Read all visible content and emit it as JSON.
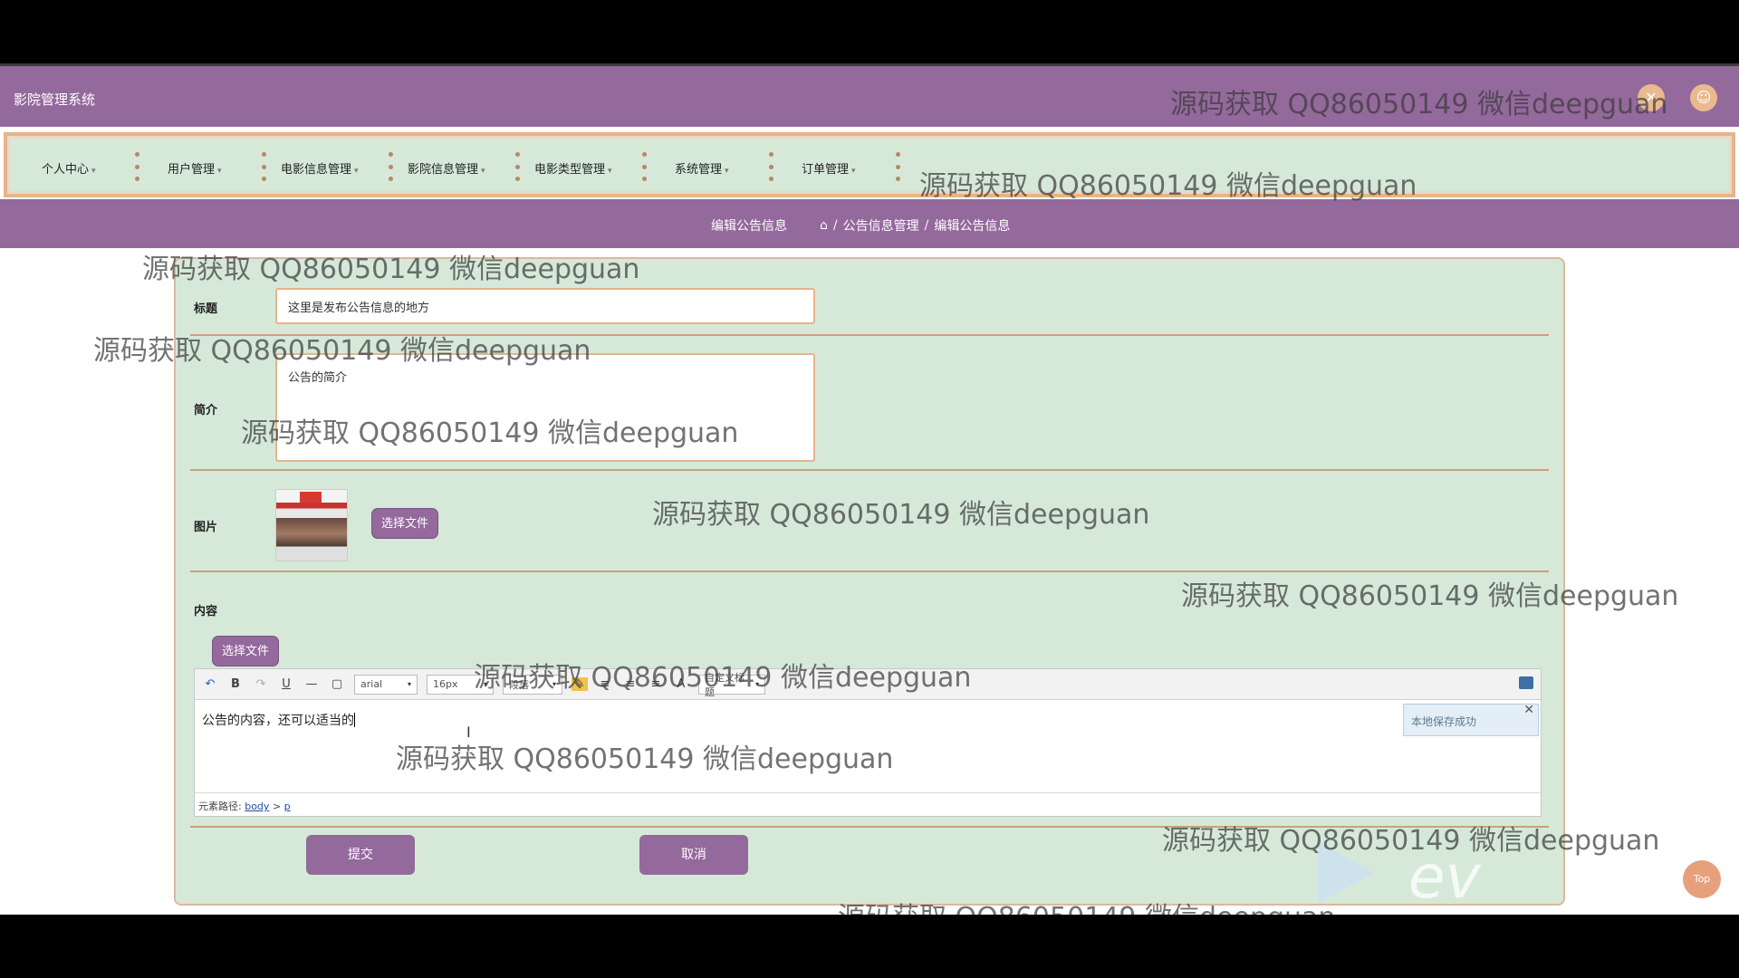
{
  "app": {
    "title": "影院管理系统"
  },
  "nav": {
    "items": [
      {
        "label": "个人中心"
      },
      {
        "label": "用户管理"
      },
      {
        "label": "电影信息管理"
      },
      {
        "label": "影院信息管理"
      },
      {
        "label": "电影类型管理"
      },
      {
        "label": "系统管理"
      },
      {
        "label": "订单管理"
      }
    ]
  },
  "breadcrumb": {
    "page_title": "编辑公告信息",
    "path": [
      "公告信息管理",
      "编辑公告信息"
    ],
    "separator": "/"
  },
  "form": {
    "title_label": "标题",
    "title_value": "这里是发布公告信息的地方",
    "summary_label": "简介",
    "summary_value": "公告的简介",
    "image_label": "图片",
    "image_button": "选择文件",
    "content_label": "内容",
    "content_button": "选择文件",
    "submit_label": "提交",
    "cancel_label": "取消"
  },
  "editor": {
    "font_family": "arial",
    "font_size": "16px",
    "paragraph": "段落",
    "custom_title": "自定义标题",
    "body_text": "公告的内容，还可以适当的",
    "toast": "本地保存成功",
    "path_label": "元素路径:",
    "path_body": "body",
    "path_sep": ">",
    "path_p": "p"
  },
  "top_button": "Top",
  "watermark": "源码获取 QQ86050149 微信deepguan",
  "overlay_logo": "ev",
  "theme": {
    "primary": "#94699c",
    "panel": "#d6e9d9",
    "accent": "#e6b48a"
  }
}
